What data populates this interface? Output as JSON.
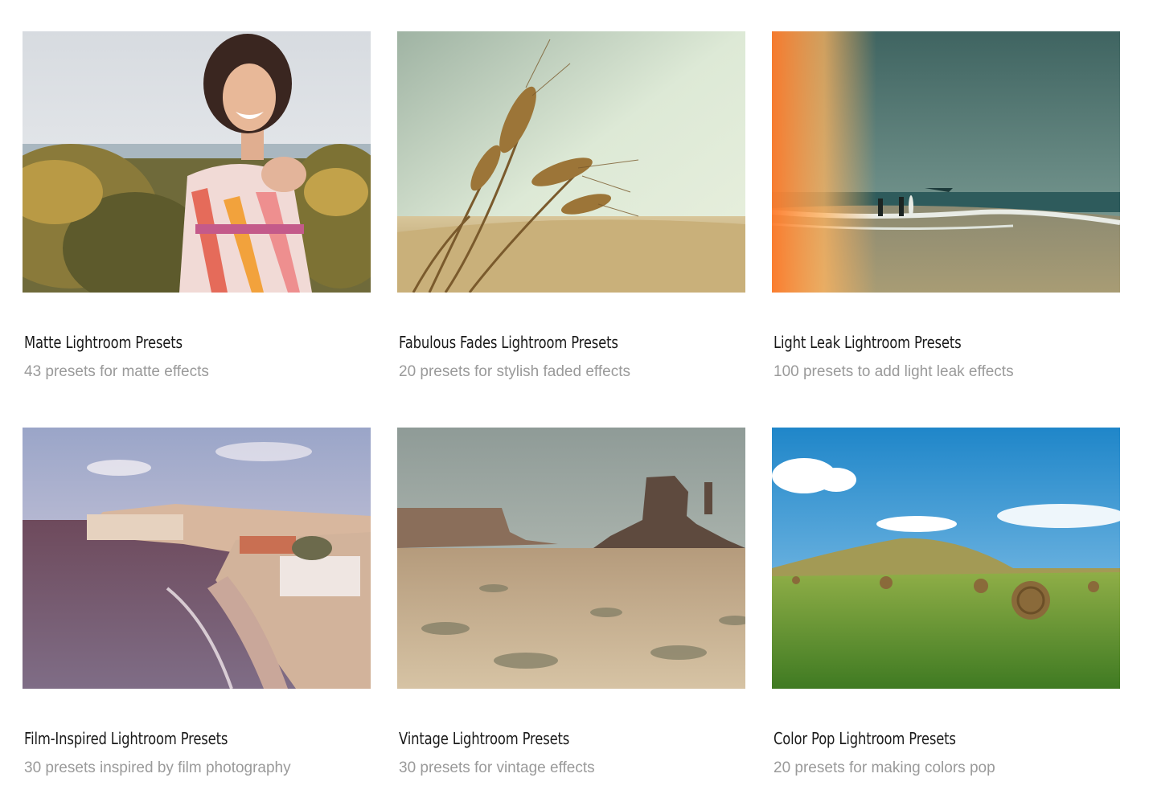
{
  "presets": [
    {
      "title": "Matte Lightroom Presets",
      "description": "43 presets for matte effects",
      "image": "woman-in-flowers-photo"
    },
    {
      "title": "Fabulous Fades Lightroom Presets",
      "description": "20 presets for stylish faded effects",
      "image": "wheat-photo"
    },
    {
      "title": "Light Leak Lightroom Presets",
      "description": "100 presets to add light leak effects",
      "image": "surf-beach-photo"
    },
    {
      "title": "Film-Inspired Lightroom Presets",
      "description": "30 presets inspired by film photography",
      "image": "coastal-town-photo"
    },
    {
      "title": "Vintage Lightroom Presets",
      "description": "30 presets for vintage effects",
      "image": "desert-butte-photo"
    },
    {
      "title": "Color Pop Lightroom Presets",
      "description": "20 presets for making colors pop",
      "image": "hay-field-photo"
    }
  ]
}
